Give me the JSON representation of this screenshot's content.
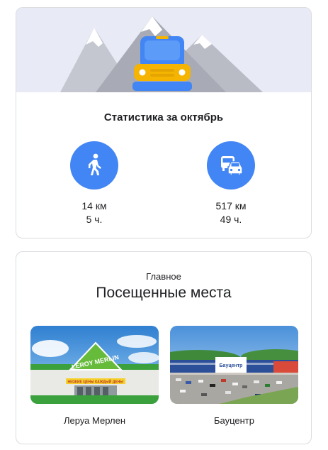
{
  "stats": {
    "title": "Статистика за октябрь",
    "walking": {
      "icon": "walking-person-icon",
      "distance": "14 км",
      "duration": "5 ч."
    },
    "driving": {
      "icon": "car-transit-icon",
      "distance": "517 км",
      "duration": "49 ч."
    }
  },
  "places": {
    "kicker": "Главное",
    "title": "Посещенные места",
    "items": [
      {
        "name": "Леруа Мерлен",
        "sign_text": "LEROY MERLIN",
        "banner_text": "НИЗКИЕ ЦЕНЫ КАЖДЫЙ ДЕНЬ!"
      },
      {
        "name": "Бауцентр",
        "sign_text": "Бауцентр"
      }
    ]
  },
  "colors": {
    "accent": "#4285f4",
    "car": "#f4b400",
    "hero_bg": "#e8eaf6",
    "mountain": "#b7b9c3"
  }
}
